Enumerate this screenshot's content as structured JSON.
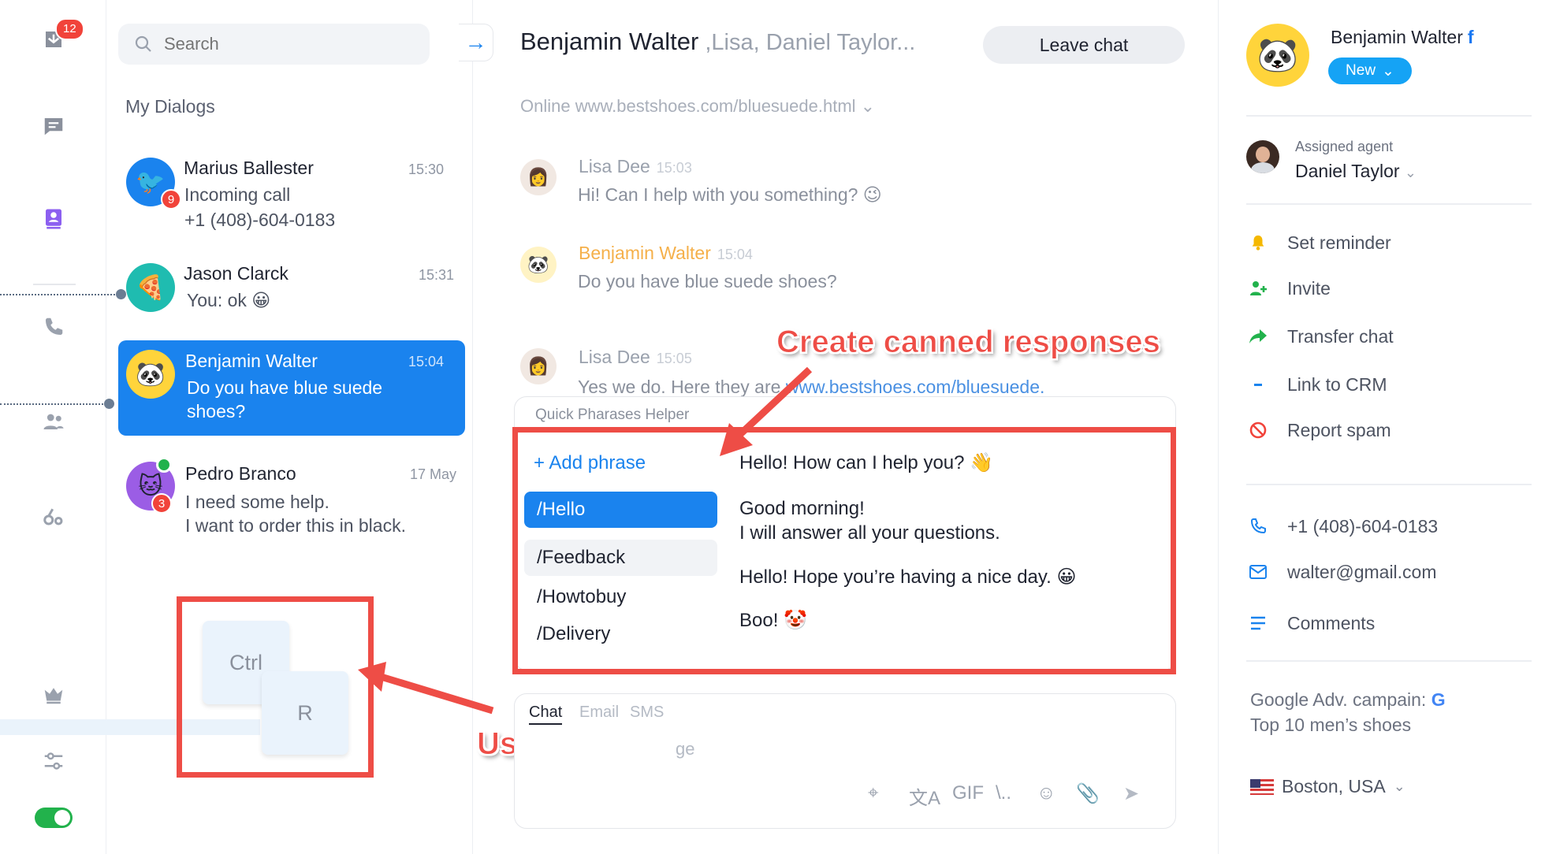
{
  "rail": {
    "inbox_badge": "12",
    "icons": [
      "inbox-icon",
      "chat-icon",
      "contacts-icon",
      "phone-icon",
      "team-icon",
      "analytics-icon",
      "crown-icon",
      "settings-icon"
    ],
    "toggle_on": true
  },
  "search": {
    "placeholder": "Search"
  },
  "dialogs": {
    "section_title": "My Dialogs",
    "items": [
      {
        "name": "Marius Ballester",
        "time": "15:30",
        "line1": "Incoming call",
        "line2": "+1 (408)-604-0183",
        "badge": "9",
        "avatar_color": "#1a83ee",
        "avatar_icon": "🐦"
      },
      {
        "name": "Jason Clarck",
        "time": "15:31",
        "line1": "You: ok 😀",
        "avatar_color": "#1fbcb0",
        "avatar_icon": "🍕"
      },
      {
        "name": "Benjamin Walter",
        "time": "15:04",
        "line1": "Do you have blue suede",
        "line2": "shoes?",
        "avatar_color": "#ffd43b",
        "avatar_icon": "🐼",
        "active": true
      },
      {
        "name": "Pedro Branco",
        "time": "17 May",
        "line1": "I need some help.",
        "line2": "I want to order this in black.",
        "badge": "3",
        "avatar_color": "#9b5de5",
        "avatar_icon": "🐱"
      }
    ]
  },
  "hotkeys": {
    "key1": "Ctrl",
    "key2": "R",
    "callout": "Use Hotkeys"
  },
  "chat": {
    "title_main": "Benjamin Walter",
    "title_others": " ,Lisa, Daniel Taylor...",
    "leave_label": "Leave chat",
    "online_text": "Online www.bestshoes.com/bluesuede.html ⌄",
    "messages": [
      {
        "author": "Lisa Dee",
        "time": "15:03",
        "text": "Hi! Can I help with you something? 😉"
      },
      {
        "author": "Benjamin Walter",
        "time": "15:04",
        "text": "Do you have blue suede shoes?"
      },
      {
        "author": "Lisa Dee",
        "time": "15:05",
        "text_prefix": "Yes we do. Here they are ",
        "link": "www.bestshoes.com/bluesuede."
      }
    ],
    "canned_callout": "Create canned responses"
  },
  "quick_phrases": {
    "title": "Quick Pharases Helper",
    "add_label": "+ Add phrase",
    "items": [
      "/Hello",
      "/Feedback",
      "/Howtobuy",
      "/Delivery"
    ],
    "phrases": [
      {
        "line1": "Hello! How can I help you? 👋"
      },
      {
        "line1": "Good morning!",
        "line2": "I will answer all your questions."
      },
      {
        "line1": "Hello! Hope you’re having a nice day. 😀"
      },
      {
        "line1": "Boo! 🤡"
      }
    ]
  },
  "composer": {
    "tabs": [
      "Chat",
      "Email",
      "SMS"
    ],
    "placeholder_visible": "ge",
    "tools": [
      "target-icon",
      "translate-icon",
      "GIF",
      "\\..",
      "emoji-icon",
      "attach-icon",
      "send-icon"
    ]
  },
  "profile": {
    "name": "Benjamin Walter",
    "network": "f",
    "status": "New",
    "assigned_label": "Assigned agent",
    "assigned_agent": "Daniel Taylor",
    "actions": [
      {
        "icon": "bell-icon",
        "label": "Set reminder",
        "color": "#f5b800"
      },
      {
        "icon": "invite-icon",
        "label": "Invite",
        "color": "#22b24c"
      },
      {
        "icon": "transfer-icon",
        "label": "Transfer chat",
        "color": "#22b24c"
      },
      {
        "icon": "crm-icon",
        "label": "Link to CRM",
        "color": "#1a83ee"
      },
      {
        "icon": "spam-icon",
        "label": "Report spam",
        "color": "#f1433a"
      }
    ],
    "phone": "+1 (408)-604-0183",
    "email": "walter@gmail.com",
    "comments": "Comments",
    "campaign_line1": "Google Adv. campain:",
    "campaign_line2": "Top 10 men’s shoes",
    "location": "Boston, USA"
  }
}
